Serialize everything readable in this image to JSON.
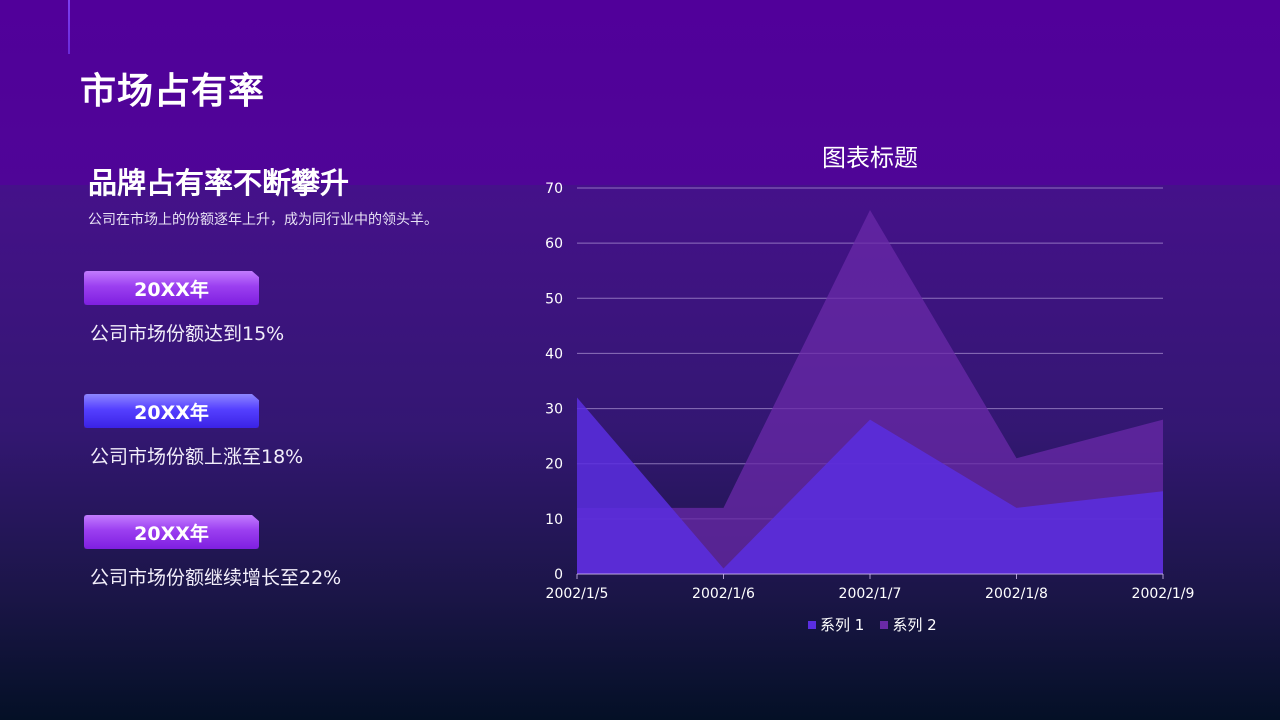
{
  "page": {
    "title": "市场占有率",
    "subtitle": "品牌占有率不断攀升",
    "description": "公司在市场上的份额逐年上升，成为同行业中的领头羊。"
  },
  "entries": [
    {
      "year": "20XX年",
      "text": "公司市场份额达到15%",
      "color": "#9b3ff0"
    },
    {
      "year": "20XX年",
      "text": "公司市场份额上涨至18%",
      "color": "#5540ff"
    },
    {
      "year": "20XX年",
      "text": "公司市场份额继续增长至22%",
      "color": "#9b3ff0"
    }
  ],
  "chart_data": {
    "type": "area",
    "title": "图表标题",
    "categories": [
      "2002/1/5",
      "2002/1/6",
      "2002/1/7",
      "2002/1/8",
      "2002/1/9"
    ],
    "series": [
      {
        "name": "系列 1",
        "values": [
          32,
          1,
          28,
          12,
          15
        ],
        "color": "#5a2ee0"
      },
      {
        "name": "系列 2",
        "values": [
          12,
          12,
          66,
          21,
          28
        ],
        "color": "#6a2aa8"
      }
    ],
    "ylim": [
      0,
      70
    ],
    "yticks": [
      0,
      10,
      20,
      30,
      40,
      50,
      60,
      70
    ],
    "grid": true,
    "legend": "bottom"
  }
}
